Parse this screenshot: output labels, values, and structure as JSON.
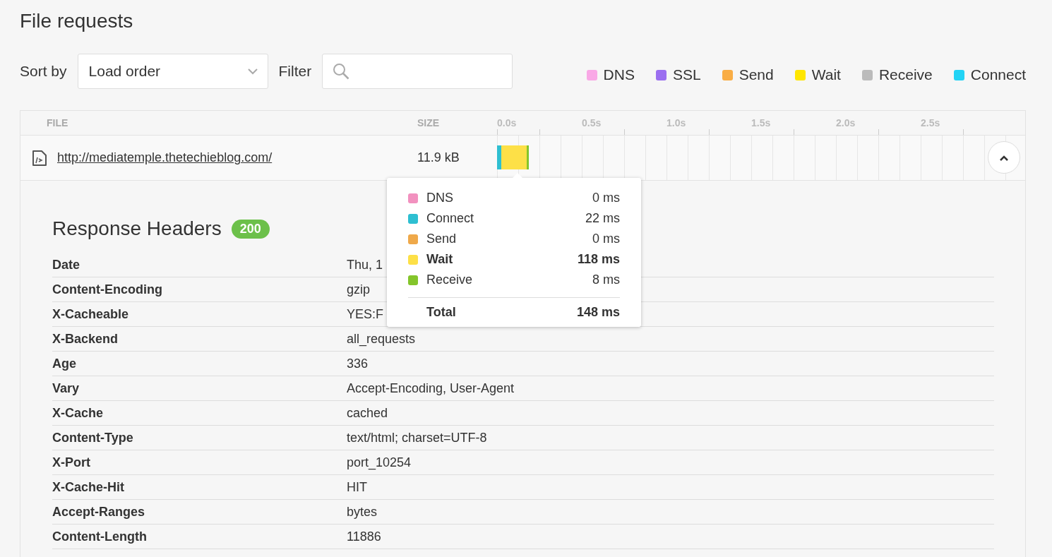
{
  "title": "File requests",
  "sort": {
    "label": "Sort by",
    "value": "Load order"
  },
  "filter": {
    "label": "Filter"
  },
  "legend": [
    {
      "label": "DNS",
      "color": "#f9a8e6"
    },
    {
      "label": "SSL",
      "color": "#9b6ff0"
    },
    {
      "label": "Send",
      "color": "#f9ad45"
    },
    {
      "label": "Wait",
      "color": "#ffe600"
    },
    {
      "label": "Receive",
      "color": "#bbbbbb"
    },
    {
      "label": "Connect",
      "color": "#22d3f5"
    }
  ],
  "table": {
    "columns": [
      "FILE",
      "SIZE"
    ],
    "ticks": [
      "0.0s",
      "0.5s",
      "1.0s",
      "1.5s",
      "2.0s",
      "2.5s"
    ],
    "rows": [
      {
        "url": "http://mediatemple.thetechieblog.com/",
        "size": "11.9 kB",
        "expanded": true
      }
    ]
  },
  "tooltip": {
    "items": [
      {
        "label": "DNS",
        "value": "0 ms",
        "color": "#f291bf",
        "emphasis": false
      },
      {
        "label": "Connect",
        "value": "22 ms",
        "color": "#2ebfd1",
        "emphasis": false
      },
      {
        "label": "Send",
        "value": "0 ms",
        "color": "#efa94a",
        "emphasis": false
      },
      {
        "label": "Wait",
        "value": "118 ms",
        "color": "#fde047",
        "emphasis": true
      },
      {
        "label": "Receive",
        "value": "8 ms",
        "color": "#84c52b",
        "emphasis": false
      }
    ],
    "total": {
      "label": "Total",
      "value": "148 ms"
    }
  },
  "response": {
    "title": "Response Headers",
    "status": "200",
    "headers": [
      {
        "name": "Date",
        "value": "Thu, 1"
      },
      {
        "name": "Content-Encoding",
        "value": "gzip"
      },
      {
        "name": "X-Cacheable",
        "value": "YES:F"
      },
      {
        "name": "X-Backend",
        "value": "all_requests"
      },
      {
        "name": "Age",
        "value": "336"
      },
      {
        "name": "Vary",
        "value": "Accept-Encoding, User-Agent"
      },
      {
        "name": "X-Cache",
        "value": "cached"
      },
      {
        "name": "Content-Type",
        "value": "text/html; charset=UTF-8"
      },
      {
        "name": "X-Port",
        "value": "port_10254"
      },
      {
        "name": "X-Cache-Hit",
        "value": "HIT"
      },
      {
        "name": "Accept-Ranges",
        "value": "bytes"
      },
      {
        "name": "Content-Length",
        "value": "11886"
      }
    ]
  }
}
